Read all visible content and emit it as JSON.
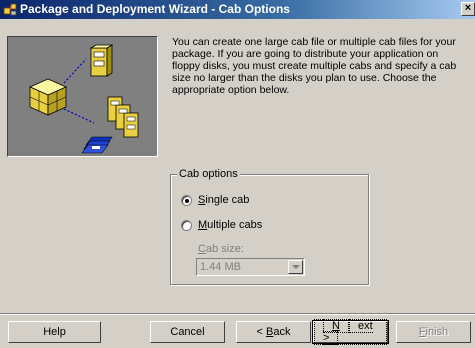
{
  "window": {
    "title": "Package and Deployment Wizard - Cab Options",
    "icon": "package-wizard-icon",
    "close_label": "×"
  },
  "description": "You can create one large cab file or multiple cab files for your package. If you are going to distribute your application on floppy disks, you must create multiple cabs and specify a cab size no larger than the disks you plan to use. Choose the appropriate option below.",
  "cab_options": {
    "group_label": "Cab options",
    "single": {
      "prefix": "",
      "accel": "S",
      "rest": "ingle cab",
      "selected": true
    },
    "multiple": {
      "prefix": "",
      "accel": "M",
      "rest": "ultiple cabs",
      "selected": false
    },
    "cab_size": {
      "label_accel": "C",
      "label_rest": "ab size:",
      "value": "1.44 MB"
    }
  },
  "buttons": {
    "help": "Help",
    "cancel": "Cancel",
    "back_prefix": "< ",
    "back_accel": "B",
    "back_rest": "ack",
    "next_accel": "N",
    "next_rest": "ext >",
    "finish_accel": "F",
    "finish_rest": "inish"
  },
  "colors": {
    "titlebar_start": "#0a246a",
    "face": "#d4d0c8",
    "art_background": "#808080"
  }
}
